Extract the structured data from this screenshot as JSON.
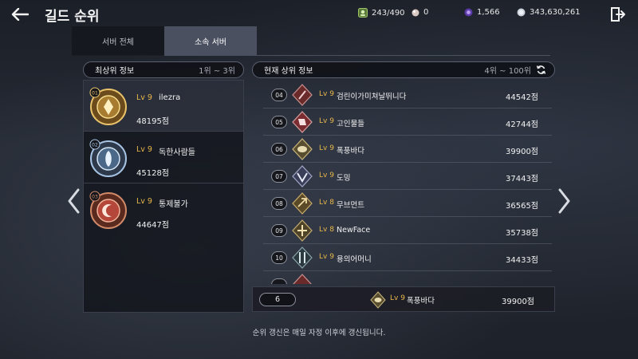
{
  "header": {
    "title": "길드 순위",
    "resources": [
      {
        "icon": "guild-member-icon",
        "value": "243/490"
      },
      {
        "icon": "pearl-icon",
        "value": "0"
      },
      {
        "icon": "purple-gem-icon",
        "value": "1,566"
      },
      {
        "icon": "silver-coin-icon",
        "value": "343,630,261"
      }
    ]
  },
  "tabs": {
    "all_label": "서버 전체",
    "sub_label": "소속 서버",
    "selected": "소속 서버"
  },
  "top_section": {
    "title": "최상위 정보",
    "range": "1위 ~ 3위",
    "items": [
      {
        "rank": "01",
        "level": "Lv 9",
        "name": "ilezra",
        "score": "48195점",
        "emblem_color": "#c89a3c"
      },
      {
        "rank": "02",
        "level": "Lv 9",
        "name": "독한사람들",
        "score": "45128점",
        "emblem_color": "#8aa6c8"
      },
      {
        "rank": "03",
        "level": "Lv 9",
        "name": "통제불가",
        "score": "44647점",
        "emblem_color": "#b4583c"
      }
    ]
  },
  "list_section": {
    "title": "현재 상위 정보",
    "range": "4위 ~ 100위",
    "rows": [
      {
        "rank": "04",
        "level": "Lv 9",
        "name": "검린이가미쳐날뛰니다",
        "score": "44542점"
      },
      {
        "rank": "05",
        "level": "Lv 9",
        "name": "고인물들",
        "score": "42744점"
      },
      {
        "rank": "06",
        "level": "Lv 9",
        "name": "폭풍바다",
        "score": "39900점"
      },
      {
        "rank": "07",
        "level": "Lv 9",
        "name": "도밍",
        "score": "37443점"
      },
      {
        "rank": "08",
        "level": "Lv 8",
        "name": "무브먼트",
        "score": "36565점"
      },
      {
        "rank": "09",
        "level": "Lv 8",
        "name": "NewFace",
        "score": "35738점"
      },
      {
        "rank": "10",
        "level": "Lv 9",
        "name": "용의어머니",
        "score": "34433점"
      }
    ]
  },
  "my_guild": {
    "rank": "6",
    "level": "Lv 9",
    "name": "폭풍바다",
    "score": "39900점"
  },
  "notice": "순위 갱신은 매일 자정 이후에 갱신됩니다.",
  "colors": {
    "level": "#e8b84a",
    "tab_active": "#4a5060",
    "panel": "#12141a"
  }
}
